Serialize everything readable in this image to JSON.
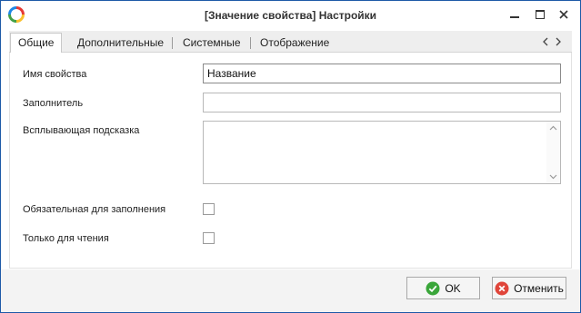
{
  "window": {
    "title": "[Значение свойства] Настройки",
    "controls": [
      "minimize-icon",
      "maximize-icon",
      "close-icon"
    ]
  },
  "tabs": [
    {
      "label": "Общие",
      "active": true
    },
    {
      "label": "Дополнительные",
      "active": false
    },
    {
      "label": "Системные",
      "active": false
    },
    {
      "label": "Отображение",
      "active": false
    }
  ],
  "form": {
    "property_name": {
      "label": "Имя свойства",
      "value": "Название"
    },
    "placeholder": {
      "label": "Заполнитель",
      "value": ""
    },
    "tooltip": {
      "label": "Всплывающая подсказка",
      "value": ""
    },
    "required": {
      "label": "Обязательная для заполнения",
      "checked": false
    },
    "readonly": {
      "label": "Только для чтения",
      "checked": false
    }
  },
  "buttons": {
    "ok": "OK",
    "cancel": "Отменить"
  },
  "colors": {
    "window_border": "#1e5aa8",
    "ok_icon": "#3aa63a",
    "cancel_icon": "#e0453a"
  }
}
